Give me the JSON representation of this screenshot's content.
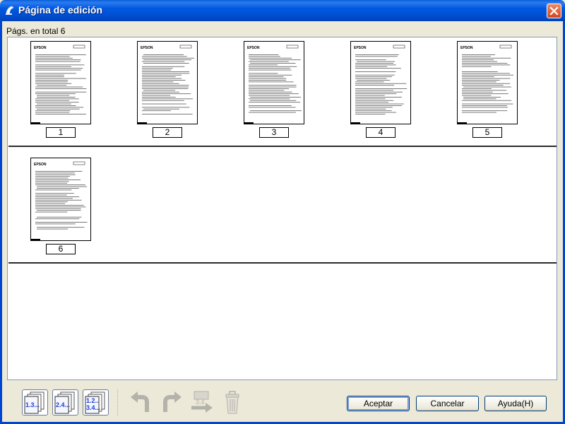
{
  "window": {
    "title": "Página de edición"
  },
  "summary": {
    "count_label": "Págs. en total 6"
  },
  "pages": [
    {
      "label": "1"
    },
    {
      "label": "2"
    },
    {
      "label": "3"
    },
    {
      "label": "4"
    },
    {
      "label": "5"
    },
    {
      "label": "6"
    }
  ],
  "thumb_logo": "EPSON",
  "toolbar": {
    "tools": [
      {
        "name": "select-odd-pages-icon",
        "text": "1.3...",
        "enabled": true
      },
      {
        "name": "select-even-pages-icon",
        "text": "2.4...",
        "enabled": true
      },
      {
        "name": "select-all-pages-icon",
        "text": "1.2.. 3.4...",
        "enabled": true
      },
      {
        "name": "rotate-left-icon",
        "enabled": false
      },
      {
        "name": "rotate-right-icon",
        "enabled": false
      },
      {
        "name": "reorder-pages-icon",
        "enabled": false
      },
      {
        "name": "delete-page-icon",
        "enabled": false
      }
    ]
  },
  "buttons": {
    "ok": "Aceptar",
    "cancel": "Cancelar",
    "help": "Ayuda(H)"
  },
  "colors": {
    "titlebar": "#0058e0",
    "frame": "#0045cf",
    "background": "#ece9d8",
    "icon_blue": "#1f3dd6"
  }
}
